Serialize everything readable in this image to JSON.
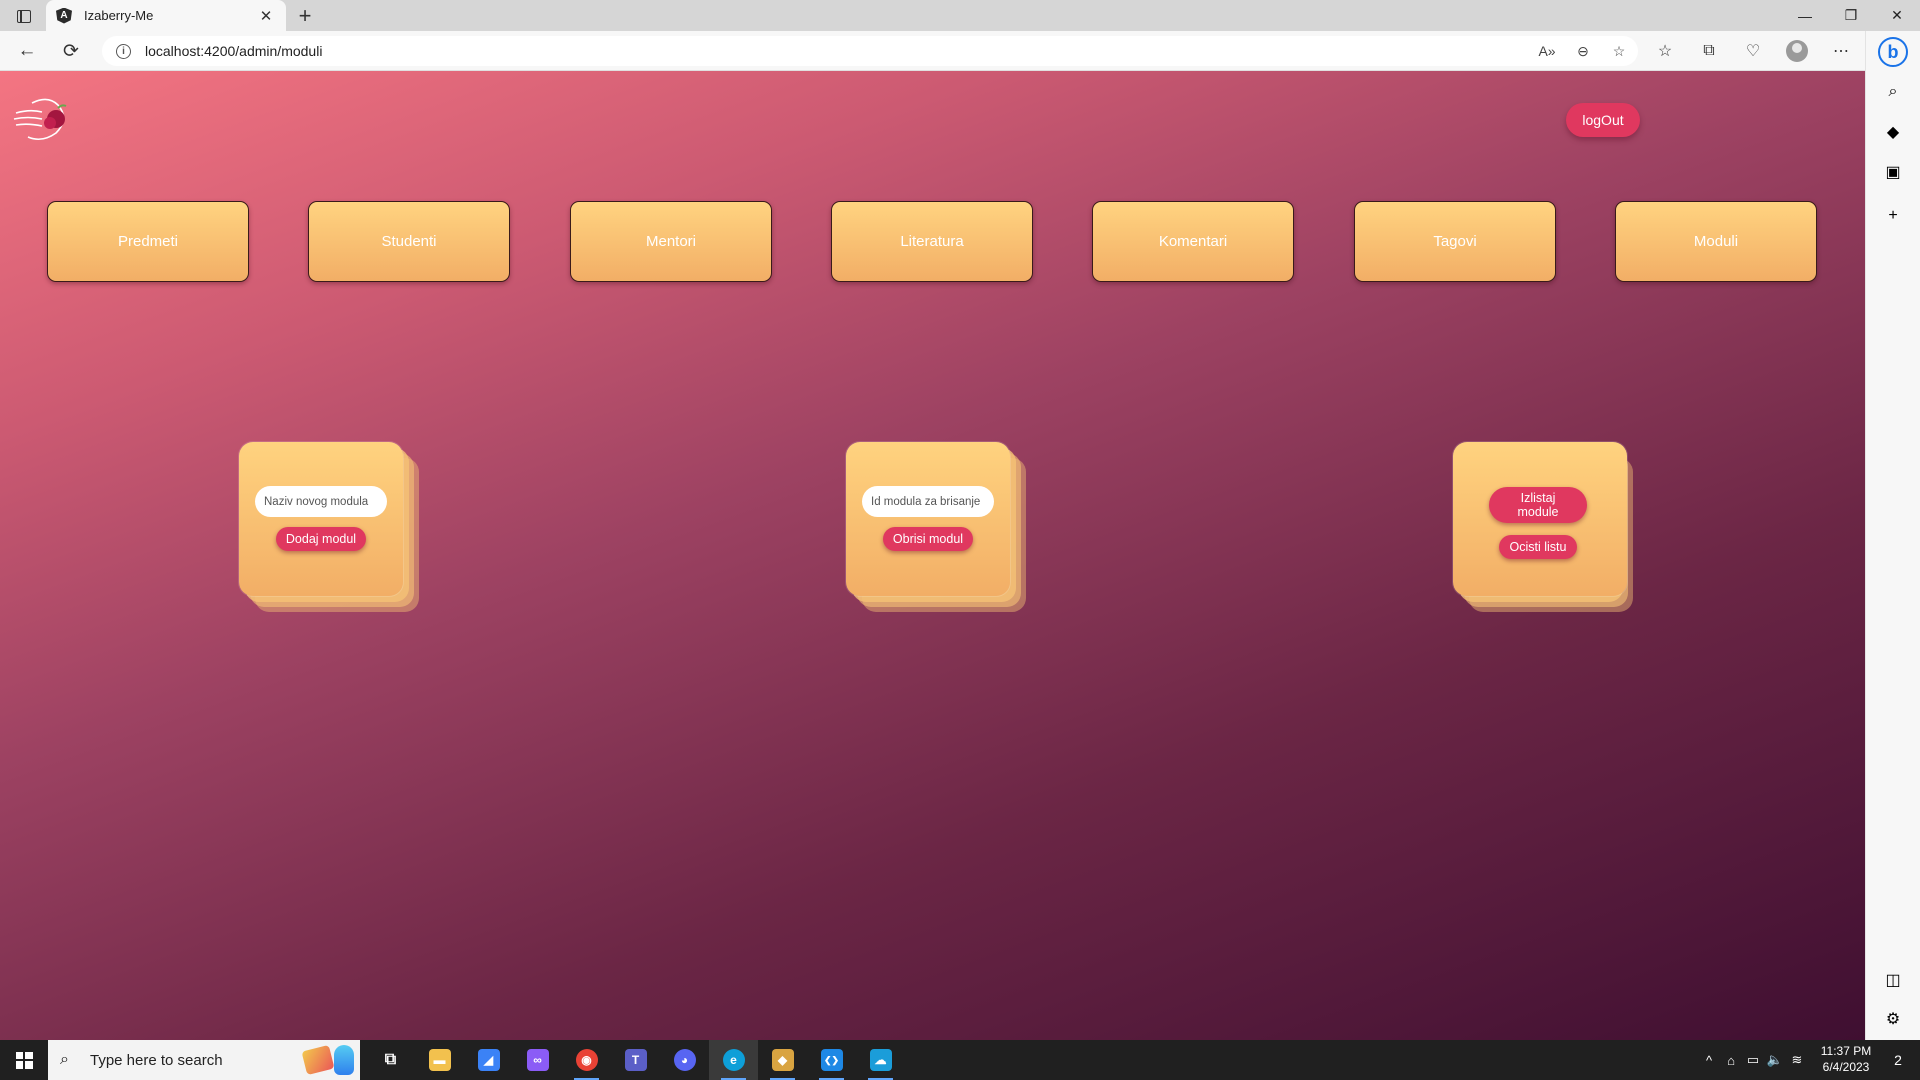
{
  "browser": {
    "tab_title": "Izaberry-Me",
    "tab_close": "✕",
    "new_tab": "+",
    "window_controls": {
      "minimize": "—",
      "maximize": "❐",
      "close": "✕"
    },
    "url": "localhost:4200/admin/moduli",
    "back_glyph": "←",
    "refresh_glyph": "⟳",
    "info_glyph": "i",
    "url_icons": [
      "A»",
      "⊖",
      "☆"
    ],
    "toolbar_icons": [
      "☆",
      "⧉",
      "♡",
      "⋯"
    ],
    "bing_glyph": "b",
    "sidebar_icons": [
      {
        "name": "search-icon",
        "glyph": "⌕",
        "color": "#1a73e8"
      },
      {
        "name": "office-icon",
        "glyph": "◆",
        "color": "#7b5cf5"
      },
      {
        "name": "outlook-icon",
        "glyph": "▣",
        "color": "#0b6cd8"
      },
      {
        "name": "add-icon",
        "glyph": "+",
        "color": "#333333"
      }
    ],
    "sidebar_bottom_icons": [
      {
        "name": "split-screen-icon",
        "glyph": "◫"
      },
      {
        "name": "settings-gear-icon",
        "glyph": "⚙"
      }
    ]
  },
  "app": {
    "logout_label": "logOut",
    "nav_items": [
      "Predmeti",
      "Studenti",
      "Mentori",
      "Literatura",
      "Komentari",
      "Tagovi",
      "Moduli"
    ],
    "cards": {
      "add": {
        "input_placeholder": "Naziv novog modula",
        "button_label": "Dodaj modul"
      },
      "delete": {
        "input_placeholder": "Id modula za brisanje",
        "button_label": "Obrisi modul"
      },
      "list": {
        "list_button_label": "Izlistaj module",
        "clear_button_label": "Ocisti listu"
      }
    },
    "colors": {
      "accent": "#e0385f",
      "tile": "#f5b86a",
      "bg_top": "#f47582",
      "bg_bottom": "#3f0f31"
    }
  },
  "taskbar": {
    "search_placeholder": "Type here to search",
    "search_glyph": "⌕",
    "apps": [
      {
        "name": "task-view-icon",
        "glyph": "⧉",
        "bg": "transparent"
      },
      {
        "name": "file-explorer-icon",
        "glyph": "▬",
        "bg": "#f2c14e"
      },
      {
        "name": "app-blue-icon",
        "glyph": "◢",
        "bg": "#3b82f6"
      },
      {
        "name": "visual-studio-icon",
        "glyph": "∞",
        "bg": "#8b5cf6"
      },
      {
        "name": "chrome-icon",
        "glyph": "◉",
        "bg": "#e94235"
      },
      {
        "name": "teams-icon",
        "glyph": "T",
        "bg": "#5b5fc7"
      },
      {
        "name": "discord-icon",
        "glyph": "◕",
        "bg": "#5865f2"
      },
      {
        "name": "edge-icon",
        "glyph": "e",
        "bg": "#0e9fd8"
      },
      {
        "name": "git-icon",
        "glyph": "◆",
        "bg": "#d9a441"
      },
      {
        "name": "vscode-icon",
        "glyph": "❮❯",
        "bg": "#1e88e5"
      },
      {
        "name": "azure-data-icon",
        "glyph": "☁",
        "bg": "#1b9dd9"
      }
    ],
    "tray_icons": [
      "^",
      "⌂",
      "▭",
      "🔈",
      "≋"
    ],
    "time": "11:37 PM",
    "date": "6/4/2023",
    "notification_count": "2"
  }
}
